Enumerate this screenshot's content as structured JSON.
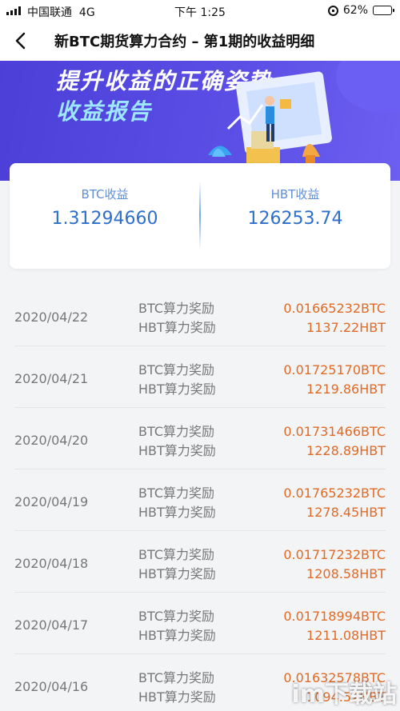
{
  "status_bar": {
    "carrier": "中国联通",
    "network": "4G",
    "time": "下午 1:25",
    "battery": "62%",
    "battery_level": 0.62
  },
  "nav": {
    "title": "新BTC期货算力合约 – 第1期的收益明细"
  },
  "banner": {
    "line1": "提升收益的正确姿势",
    "line2": "收益报告"
  },
  "summary": {
    "btc_label": "BTC收益",
    "btc_value": "1.31294660",
    "hbt_label": "HBT收益",
    "hbt_value": "126253.74"
  },
  "rows": [
    {
      "date": "2020/04/22",
      "name1": "BTC算力奖励",
      "name2": "HBT算力奖励",
      "val1": "0.01665232BTC",
      "val2": "1137.22HBT"
    },
    {
      "date": "2020/04/21",
      "name1": "BTC算力奖励",
      "name2": "HBT算力奖励",
      "val1": "0.01725170BTC",
      "val2": "1219.86HBT"
    },
    {
      "date": "2020/04/20",
      "name1": "BTC算力奖励",
      "name2": "HBT算力奖励",
      "val1": "0.01731466BTC",
      "val2": "1228.89HBT"
    },
    {
      "date": "2020/04/19",
      "name1": "BTC算力奖励",
      "name2": "HBT算力奖励",
      "val1": "0.01765232BTC",
      "val2": "1278.45HBT"
    },
    {
      "date": "2020/04/18",
      "name1": "BTC算力奖励",
      "name2": "HBT算力奖励",
      "val1": "0.01717232BTC",
      "val2": "1208.58HBT"
    },
    {
      "date": "2020/04/17",
      "name1": "BTC算力奖励",
      "name2": "HBT算力奖励",
      "val1": "0.01718994BTC",
      "val2": "1211.08HBT"
    },
    {
      "date": "2020/04/16",
      "name1": "BTC算力奖励",
      "name2": "HBT算力奖励",
      "val1": "0.01632578BTC",
      "val2": "1094.52HBT"
    }
  ],
  "watermark": "im下载站",
  "colors": {
    "accent": "#2c6fcc",
    "value_orange": "#e06a26",
    "banner": "#5b4fe6"
  }
}
